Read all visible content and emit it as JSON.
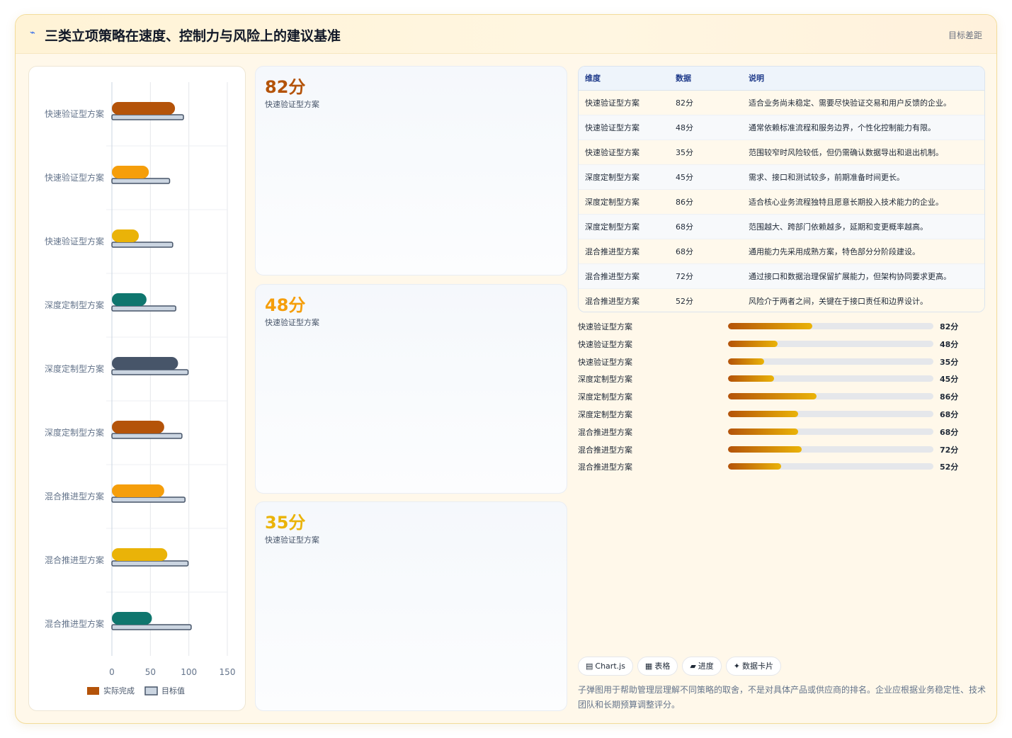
{
  "header": {
    "icon": "lightning-icon",
    "title": "三类立项策略在速度、控制力与风险上的建议基准",
    "right_label": "目标差距"
  },
  "chart_data": {
    "type": "bar",
    "orientation": "horizontal",
    "categories": [
      "快速验证型方案",
      "快速验证型方案",
      "快速验证型方案",
      "深度定制型方案",
      "深度定制型方案",
      "深度定制型方案",
      "混合推进型方案",
      "混合推进型方案",
      "混合推进型方案"
    ],
    "series": [
      {
        "name": "实际完成",
        "values": [
          82,
          48,
          35,
          45,
          86,
          68,
          68,
          72,
          52
        ],
        "colors": [
          "#b45309",
          "#f59e0b",
          "#eab308",
          "#0f766e",
          "#475569",
          "#b45309",
          "#f59e0b",
          "#eab308",
          "#0f766e"
        ]
      },
      {
        "name": "目标值",
        "values": [
          93,
          75,
          79,
          83,
          99,
          91,
          95,
          99,
          103
        ],
        "color": "#cbd5e1",
        "border": "#475569"
      }
    ],
    "xlim": [
      0,
      150
    ],
    "xticks": [
      0,
      50,
      100,
      150
    ],
    "grid": true,
    "legend": "bottom"
  },
  "cards": [
    {
      "value": "82分",
      "label": "快速验证型方案",
      "color": "#b45309"
    },
    {
      "value": "48分",
      "label": "快速验证型方案",
      "color": "#f59e0b"
    },
    {
      "value": "35分",
      "label": "快速验证型方案",
      "color": "#eab308"
    }
  ],
  "table": {
    "headers": [
      "维度",
      "数据",
      "说明"
    ],
    "rows": [
      [
        "快速验证型方案",
        "82分",
        "适合业务尚未稳定、需要尽快验证交易和用户反馈的企业。"
      ],
      [
        "快速验证型方案",
        "48分",
        "通常依赖标准流程和服务边界，个性化控制能力有限。"
      ],
      [
        "快速验证型方案",
        "35分",
        "范围较窄时风险较低，但仍需确认数据导出和退出机制。"
      ],
      [
        "深度定制型方案",
        "45分",
        "需求、接口和测试较多，前期准备时间更长。"
      ],
      [
        "深度定制型方案",
        "86分",
        "适合核心业务流程独特且愿意长期投入技术能力的企业。"
      ],
      [
        "深度定制型方案",
        "68分",
        "范围越大、跨部门依赖越多，延期和变更概率越高。"
      ],
      [
        "混合推进型方案",
        "68分",
        "通用能力先采用成熟方案，特色部分分阶段建设。"
      ],
      [
        "混合推进型方案",
        "72分",
        "通过接口和数据治理保留扩展能力，但架构协同要求更高。"
      ],
      [
        "混合推进型方案",
        "52分",
        "风险介于两者之间，关键在于接口责任和边界设计。"
      ]
    ]
  },
  "progress": [
    {
      "label": "快速验证型方案",
      "value": 82,
      "display": "82分"
    },
    {
      "label": "快速验证型方案",
      "value": 48,
      "display": "48分"
    },
    {
      "label": "快速验证型方案",
      "value": 35,
      "display": "35分"
    },
    {
      "label": "深度定制型方案",
      "value": 45,
      "display": "45分"
    },
    {
      "label": "深度定制型方案",
      "value": 86,
      "display": "86分"
    },
    {
      "label": "深度定制型方案",
      "value": 68,
      "display": "68分"
    },
    {
      "label": "混合推进型方案",
      "value": 68,
      "display": "68分"
    },
    {
      "label": "混合推进型方案",
      "value": 72,
      "display": "72分"
    },
    {
      "label": "混合推进型方案",
      "value": 52,
      "display": "52分"
    }
  ],
  "progress_max": 200,
  "tags": [
    {
      "icon": "▤",
      "label": "Chart.js"
    },
    {
      "icon": "▦",
      "label": "表格"
    },
    {
      "icon": "▰",
      "label": "进度"
    },
    {
      "icon": "✦",
      "label": "数据卡片"
    }
  ],
  "note": "子弹图用于帮助管理层理解不同策略的取舍，不是对具体产品或供应商的排名。企业应根据业务稳定性、技术团队和长期预算调整评分。"
}
